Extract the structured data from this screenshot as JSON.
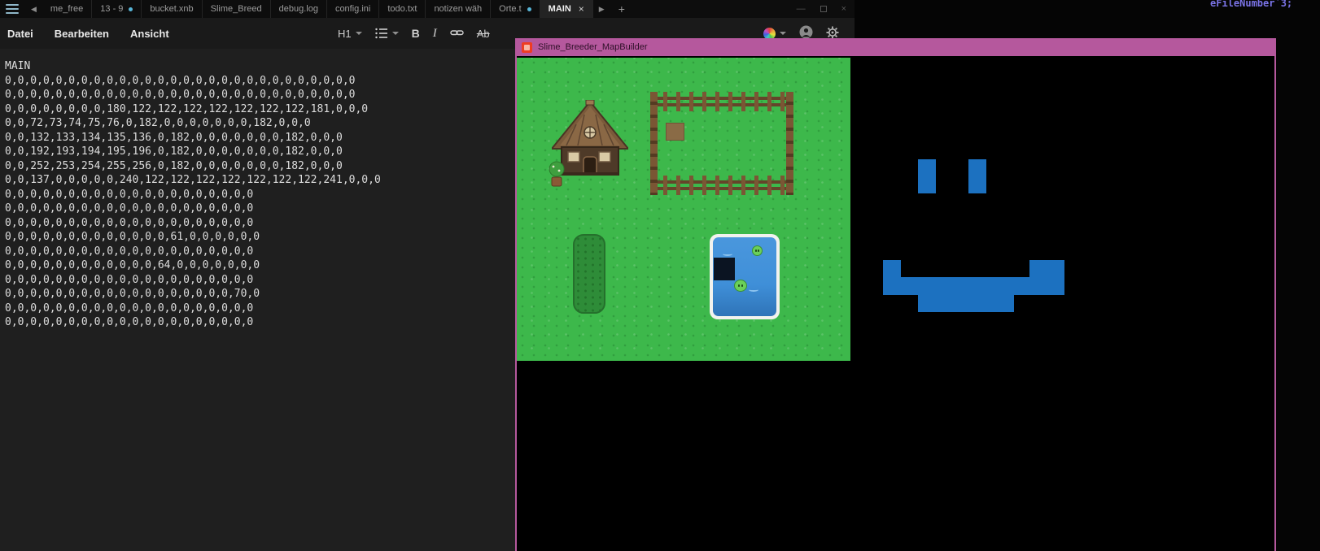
{
  "background_app": {
    "code_fragment": "eFileNumber`3;"
  },
  "tab_bar": {
    "back_icon": "◀",
    "forward_icon": "▶",
    "new_tab": "+",
    "unsaved_dot_color": "#58b6d8",
    "tabs": [
      {
        "label": "me_free",
        "dot": false,
        "active": false
      },
      {
        "label": "13 - 9",
        "dot": true,
        "active": false
      },
      {
        "label": "bucket.xnb",
        "dot": false,
        "active": false
      },
      {
        "label": "Slime_Breed",
        "dot": false,
        "active": false
      },
      {
        "label": "debug.log",
        "dot": false,
        "active": false
      },
      {
        "label": "config.ini",
        "dot": false,
        "active": false
      },
      {
        "label": "todo.txt",
        "dot": false,
        "active": false
      },
      {
        "label": "notizen wäh",
        "dot": false,
        "active": false
      },
      {
        "label": "Orte.t",
        "dot": true,
        "active": false
      },
      {
        "label": "MAIN",
        "dot": false,
        "active": true
      }
    ],
    "close_glyph": "×"
  },
  "window_controls": {
    "minimize": "—",
    "close": "×"
  },
  "menu_bar": {
    "items": [
      "Datei",
      "Bearbeiten",
      "Ansicht"
    ]
  },
  "toolbar": {
    "heading": "H1",
    "bold": "B",
    "italic": "I",
    "strike": "Ab"
  },
  "editor": {
    "heading": "MAIN",
    "rows": [
      "0,0,0,0,0,0,0,0,0,0,0,0,0,0,0,0,0,0,0,0,0,0,0,0,0,0,0,0",
      "0,0,0,0,0,0,0,0,0,0,0,0,0,0,0,0,0,0,0,0,0,0,0,0,0,0,0,0",
      "0,0,0,0,0,0,0,0,180,122,122,122,122,122,122,122,181,0,0,0",
      "0,0,72,73,74,75,76,0,182,0,0,0,0,0,0,0,182,0,0,0",
      "0,0,132,133,134,135,136,0,182,0,0,0,0,0,0,0,182,0,0,0",
      "0,0,192,193,194,195,196,0,182,0,0,0,0,0,0,0,182,0,0,0",
      "0,0,252,253,254,255,256,0,182,0,0,0,0,0,0,0,182,0,0,0",
      "0,0,137,0,0,0,0,0,240,122,122,122,122,122,122,122,241,0,0,0",
      "0,0,0,0,0,0,0,0,0,0,0,0,0,0,0,0,0,0,0,0",
      "0,0,0,0,0,0,0,0,0,0,0,0,0,0,0,0,0,0,0,0",
      "0,0,0,0,0,0,0,0,0,0,0,0,0,0,0,0,0,0,0,0",
      "0,0,0,0,0,0,0,0,0,0,0,0,0,61,0,0,0,0,0,0",
      "0,0,0,0,0,0,0,0,0,0,0,0,0,0,0,0,0,0,0,0",
      "0,0,0,0,0,0,0,0,0,0,0,0,64,0,0,0,0,0,0,0",
      "0,0,0,0,0,0,0,0,0,0,0,0,0,0,0,0,0,0,0,0",
      "0,0,0,0,0,0,0,0,0,0,0,0,0,0,0,0,0,0,70,0",
      "0,0,0,0,0,0,0,0,0,0,0,0,0,0,0,0,0,0,0,0",
      "0,0,0,0,0,0,0,0,0,0,0,0,0,0,0,0,0,0,0,0"
    ]
  },
  "map_builder": {
    "title": "Slime_Breeder_MapBuilder",
    "colors": {
      "title_bar": "#b5589d",
      "grass": "#3db84b",
      "water": "#3f8fd8",
      "smiley_blue": "#1c71c0",
      "app_icon_red": "#ee3d23"
    }
  }
}
